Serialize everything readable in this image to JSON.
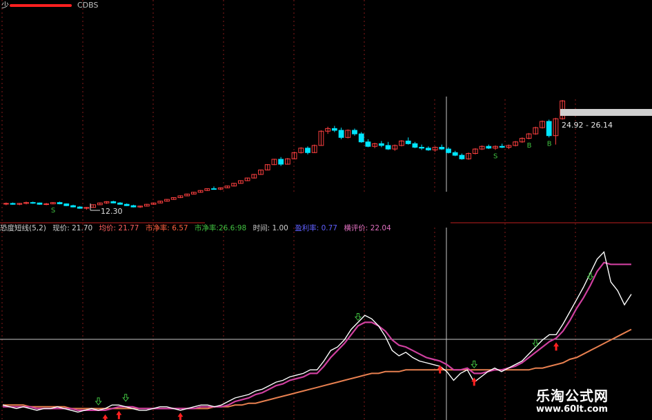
{
  "header": {
    "title": "少",
    "mode_label": "CDBS"
  },
  "indicator_bar": {
    "name": "恐度短线(5,2)",
    "price_label": "现价: 21.70",
    "avg_label": "均价: 21.77",
    "pe_label": "市净率: 6.57",
    "pe2_label": "市净率:26.6:98",
    "time_label": "时间: 1.00",
    "extra_label": "盈利率: 0.77",
    "eval_label": "横评价: 22.04"
  },
  "annotations": {
    "low_price": "12.30",
    "range_label": "24.92 - 26.14",
    "b_marker": "B",
    "s_marker": "S"
  },
  "watermark": {
    "line1": "乐淘公式网",
    "line2": "www.60lt.com"
  },
  "colors": {
    "up": "#ff4040",
    "down": "#00e5ff",
    "white_line": "#ffffff",
    "magenta_line": "#d040a0",
    "orange_line": "#e88050",
    "grid": "#8a1a1a",
    "text_white": "#d0d0d0"
  },
  "chart_data": [
    {
      "type": "candlestick",
      "title": "",
      "annotations": [
        "12.30",
        "24.92 - 26.14",
        "B",
        "S"
      ],
      "candles": [
        [
          12.95,
          13.1,
          12.8,
          13.0
        ],
        [
          13.0,
          13.1,
          12.85,
          12.9
        ],
        [
          12.9,
          13.05,
          12.8,
          13.0
        ],
        [
          13.0,
          13.2,
          12.9,
          13.1
        ],
        [
          13.1,
          13.2,
          12.95,
          13.05
        ],
        [
          13.05,
          13.1,
          12.85,
          12.9
        ],
        [
          12.9,
          13.05,
          12.8,
          12.95
        ],
        [
          12.95,
          13.15,
          12.9,
          13.1
        ],
        [
          13.1,
          13.2,
          12.9,
          12.95
        ],
        [
          12.95,
          13.0,
          12.7,
          12.75
        ],
        [
          12.75,
          12.85,
          12.55,
          12.6
        ],
        [
          12.6,
          12.7,
          12.4,
          12.45
        ],
        [
          12.45,
          12.6,
          12.3,
          12.55
        ],
        [
          12.55,
          12.9,
          12.5,
          12.85
        ],
        [
          12.85,
          13.1,
          12.8,
          13.05
        ],
        [
          13.05,
          13.25,
          12.95,
          13.2
        ],
        [
          13.2,
          13.3,
          13.0,
          13.05
        ],
        [
          13.05,
          13.15,
          12.85,
          12.9
        ],
        [
          12.9,
          13.0,
          12.7,
          12.75
        ],
        [
          12.75,
          12.85,
          12.55,
          12.6
        ],
        [
          12.6,
          12.75,
          12.5,
          12.7
        ],
        [
          12.7,
          12.95,
          12.65,
          12.9
        ],
        [
          12.9,
          13.1,
          12.85,
          13.05
        ],
        [
          13.05,
          13.3,
          13.0,
          13.25
        ],
        [
          13.25,
          13.5,
          13.2,
          13.45
        ],
        [
          13.45,
          13.7,
          13.4,
          13.65
        ],
        [
          13.65,
          13.9,
          13.6,
          13.85
        ],
        [
          13.85,
          14.1,
          13.8,
          14.05
        ],
        [
          14.05,
          14.3,
          14.0,
          14.25
        ],
        [
          14.25,
          14.5,
          14.2,
          14.45
        ],
        [
          14.45,
          14.7,
          14.4,
          14.65
        ],
        [
          14.65,
          14.9,
          14.55,
          14.6
        ],
        [
          14.6,
          14.8,
          14.5,
          14.75
        ],
        [
          14.75,
          15.0,
          14.7,
          14.95
        ],
        [
          14.95,
          15.3,
          14.9,
          15.25
        ],
        [
          15.25,
          15.6,
          15.2,
          15.55
        ],
        [
          15.55,
          15.9,
          15.5,
          15.85
        ],
        [
          15.85,
          16.3,
          15.8,
          16.25
        ],
        [
          16.25,
          16.8,
          16.2,
          16.75
        ],
        [
          16.75,
          17.4,
          16.7,
          17.35
        ],
        [
          17.35,
          18.0,
          17.3,
          17.95
        ],
        [
          17.95,
          18.2,
          17.2,
          17.4
        ],
        [
          17.4,
          18.1,
          17.35,
          18.0
        ],
        [
          18.0,
          18.8,
          17.95,
          18.7
        ],
        [
          18.7,
          19.3,
          18.6,
          19.2
        ],
        [
          19.2,
          19.4,
          18.5,
          18.7
        ],
        [
          18.7,
          19.6,
          18.65,
          19.5
        ],
        [
          19.5,
          21.2,
          19.45,
          21.1
        ],
        [
          21.1,
          21.6,
          20.8,
          21.4
        ],
        [
          21.4,
          21.7,
          21.0,
          21.2
        ],
        [
          21.2,
          21.5,
          20.2,
          20.4
        ],
        [
          20.4,
          21.3,
          20.3,
          21.2
        ],
        [
          21.2,
          21.4,
          20.6,
          20.8
        ],
        [
          20.8,
          21.0,
          19.8,
          19.9
        ],
        [
          19.9,
          20.2,
          19.3,
          19.4
        ],
        [
          19.4,
          19.8,
          19.2,
          19.7
        ],
        [
          19.7,
          20.0,
          19.3,
          19.5
        ],
        [
          19.5,
          19.9,
          19.0,
          19.1
        ],
        [
          19.1,
          19.6,
          18.9,
          19.5
        ],
        [
          19.5,
          20.1,
          19.4,
          20.0
        ],
        [
          20.0,
          20.4,
          19.6,
          19.7
        ],
        [
          19.7,
          19.9,
          19.2,
          19.3
        ],
        [
          19.3,
          19.6,
          19.0,
          19.2
        ],
        [
          19.2,
          19.4,
          18.9,
          19.0
        ],
        [
          19.0,
          19.4,
          18.8,
          19.3
        ],
        [
          19.3,
          19.6,
          19.0,
          19.1
        ],
        [
          19.1,
          19.3,
          18.6,
          18.7
        ],
        [
          18.7,
          18.9,
          18.3,
          18.4
        ],
        [
          18.4,
          18.6,
          17.9,
          18.0
        ],
        [
          18.0,
          18.7,
          17.9,
          18.6
        ],
        [
          18.6,
          19.2,
          18.5,
          19.1
        ],
        [
          19.1,
          19.5,
          19.0,
          19.4
        ],
        [
          19.4,
          19.6,
          19.1,
          19.2
        ],
        [
          19.2,
          19.5,
          19.0,
          19.4
        ],
        [
          19.4,
          19.7,
          19.2,
          19.3
        ],
        [
          19.3,
          19.6,
          19.1,
          19.5
        ],
        [
          19.5,
          20.0,
          19.4,
          19.9
        ],
        [
          19.9,
          20.4,
          19.8,
          20.3
        ],
        [
          20.3,
          20.9,
          20.2,
          20.8
        ],
        [
          20.8,
          21.6,
          20.7,
          21.5
        ],
        [
          21.5,
          22.3,
          21.4,
          22.2
        ],
        [
          22.2,
          22.4,
          20.4,
          20.6
        ],
        [
          20.6,
          22.6,
          19.6,
          22.5
        ],
        [
          22.5,
          24.6,
          22.4,
          24.5
        ]
      ]
    },
    {
      "type": "line",
      "title": "恐度短线(5,2)",
      "series": [
        {
          "values": [
            0.05,
            0.04,
            0.03,
            0.04,
            0.03,
            0.02,
            0.03,
            0.03,
            0.04,
            0.03,
            0.02,
            0.01,
            0.02,
            0.03,
            0.02,
            0.03,
            0.05,
            0.05,
            0.04,
            0.03,
            0.02,
            0.02,
            0.03,
            0.04,
            0.04,
            0.03,
            0.02,
            0.03,
            0.04,
            0.05,
            0.05,
            0.04,
            0.05,
            0.07,
            0.09,
            0.1,
            0.11,
            0.13,
            0.14,
            0.16,
            0.18,
            0.19,
            0.21,
            0.22,
            0.23,
            0.25,
            0.25,
            0.3,
            0.36,
            0.38,
            0.42,
            0.48,
            0.52,
            0.56,
            0.54,
            0.5,
            0.44,
            0.36,
            0.33,
            0.35,
            0.32,
            0.3,
            0.29,
            0.28,
            0.27,
            0.24,
            0.19,
            0.23,
            0.25,
            0.18,
            0.21,
            0.24,
            0.26,
            0.24,
            0.26,
            0.28,
            0.3,
            0.34,
            0.38,
            0.42,
            0.45,
            0.45,
            0.51,
            0.58,
            0.65,
            0.72,
            0.8,
            0.88,
            0.92,
            0.75,
            0.7,
            0.62,
            0.68
          ]
        },
        {
          "values": [
            0.04,
            0.04,
            0.04,
            0.04,
            0.04,
            0.03,
            0.03,
            0.03,
            0.03,
            0.03,
            0.03,
            0.02,
            0.02,
            0.02,
            0.02,
            0.02,
            0.03,
            0.04,
            0.04,
            0.04,
            0.03,
            0.03,
            0.03,
            0.03,
            0.03,
            0.03,
            0.03,
            0.03,
            0.03,
            0.04,
            0.04,
            0.04,
            0.04,
            0.05,
            0.07,
            0.08,
            0.09,
            0.11,
            0.12,
            0.14,
            0.16,
            0.17,
            0.19,
            0.2,
            0.21,
            0.23,
            0.23,
            0.27,
            0.32,
            0.36,
            0.4,
            0.45,
            0.5,
            0.52,
            0.52,
            0.5,
            0.47,
            0.42,
            0.39,
            0.38,
            0.36,
            0.34,
            0.32,
            0.31,
            0.3,
            0.28,
            0.25,
            0.25,
            0.26,
            0.23,
            0.23,
            0.24,
            0.25,
            0.25,
            0.26,
            0.27,
            0.29,
            0.32,
            0.35,
            0.38,
            0.41,
            0.43,
            0.47,
            0.53,
            0.6,
            0.66,
            0.73,
            0.81,
            0.86,
            0.85,
            0.85,
            0.85,
            0.85
          ]
        },
        {
          "values": [
            0.05,
            0.05,
            0.05,
            0.05,
            0.04,
            0.04,
            0.04,
            0.04,
            0.04,
            0.04,
            0.03,
            0.03,
            0.03,
            0.03,
            0.03,
            0.03,
            0.03,
            0.03,
            0.03,
            0.03,
            0.03,
            0.03,
            0.03,
            0.03,
            0.03,
            0.03,
            0.03,
            0.03,
            0.03,
            0.03,
            0.03,
            0.04,
            0.04,
            0.04,
            0.05,
            0.05,
            0.06,
            0.06,
            0.07,
            0.08,
            0.09,
            0.1,
            0.11,
            0.12,
            0.13,
            0.14,
            0.15,
            0.16,
            0.17,
            0.18,
            0.19,
            0.2,
            0.21,
            0.22,
            0.23,
            0.23,
            0.24,
            0.24,
            0.24,
            0.25,
            0.25,
            0.25,
            0.25,
            0.25,
            0.25,
            0.25,
            0.25,
            0.25,
            0.25,
            0.25,
            0.25,
            0.25,
            0.25,
            0.25,
            0.25,
            0.25,
            0.25,
            0.25,
            0.26,
            0.26,
            0.27,
            0.28,
            0.29,
            0.31,
            0.32,
            0.34,
            0.36,
            0.38,
            0.4,
            0.42,
            0.44,
            0.46,
            0.48
          ]
        }
      ]
    }
  ]
}
